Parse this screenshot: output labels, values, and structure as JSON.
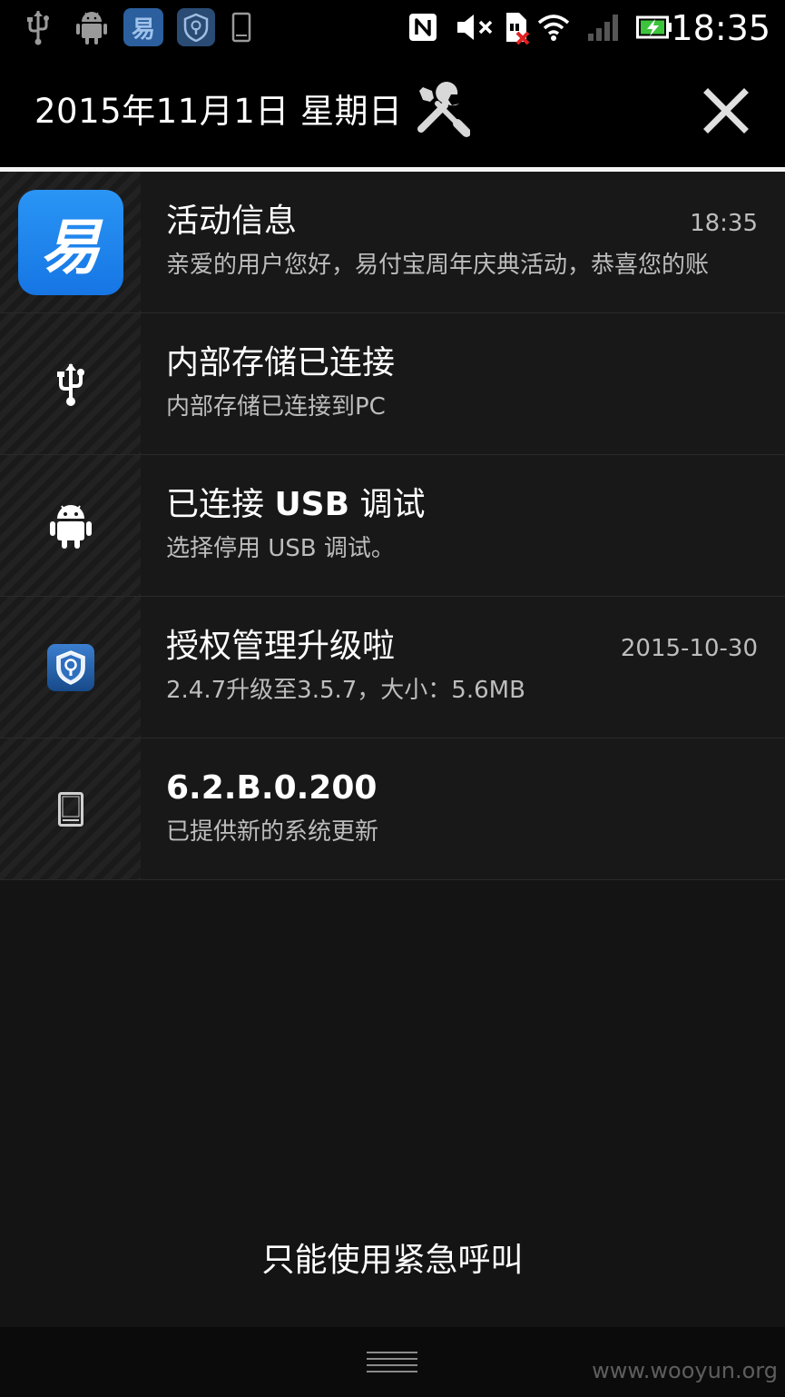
{
  "status_bar": {
    "time": "18:35",
    "left_icons": [
      "usb-icon",
      "android-debug-icon",
      "yi-app-icon",
      "shield-app-icon",
      "phone-update-icon"
    ],
    "right_icons": [
      "nfc-icon",
      "mute-icon",
      "no-sim-icon",
      "wifi-icon",
      "signal-icon",
      "battery-charging-icon"
    ]
  },
  "header": {
    "date": "2015年11月1日 星期日",
    "settings_icon": "tools-icon",
    "close_icon": "close-icon"
  },
  "notifications": [
    {
      "icon": "yi-app-icon",
      "icon_glyph": "易",
      "title": "活动信息",
      "subtitle": "亲爱的用户您好，易付宝周年庆典活动，恭喜您的账",
      "time": "18:35"
    },
    {
      "icon": "usb-icon",
      "title": "内部存储已连接",
      "subtitle": "内部存储已连接到PC",
      "time": ""
    },
    {
      "icon": "android-icon",
      "title_parts": [
        "已连接 ",
        "USB",
        " 调试"
      ],
      "subtitle": "选择停用 USB 调试。",
      "time": ""
    },
    {
      "icon": "shield-app-icon",
      "title": "授权管理升级啦",
      "subtitle": "2.4.7升级至3.5.7，大小：5.6MB",
      "time": "2015-10-30"
    },
    {
      "icon": "phone-update-icon",
      "title": "6.2.B.0.200",
      "subtitle": "已提供新的系统更新",
      "time": ""
    }
  ],
  "emergency_text": "只能使用紧急呼叫",
  "bottom": {
    "handle_icon": "drag-handle-icon",
    "watermark": "www.wooyun.org"
  },
  "colors": {
    "accent_blue": "#1e88f0",
    "background": "#141414",
    "divider": "#f4f4f4"
  }
}
